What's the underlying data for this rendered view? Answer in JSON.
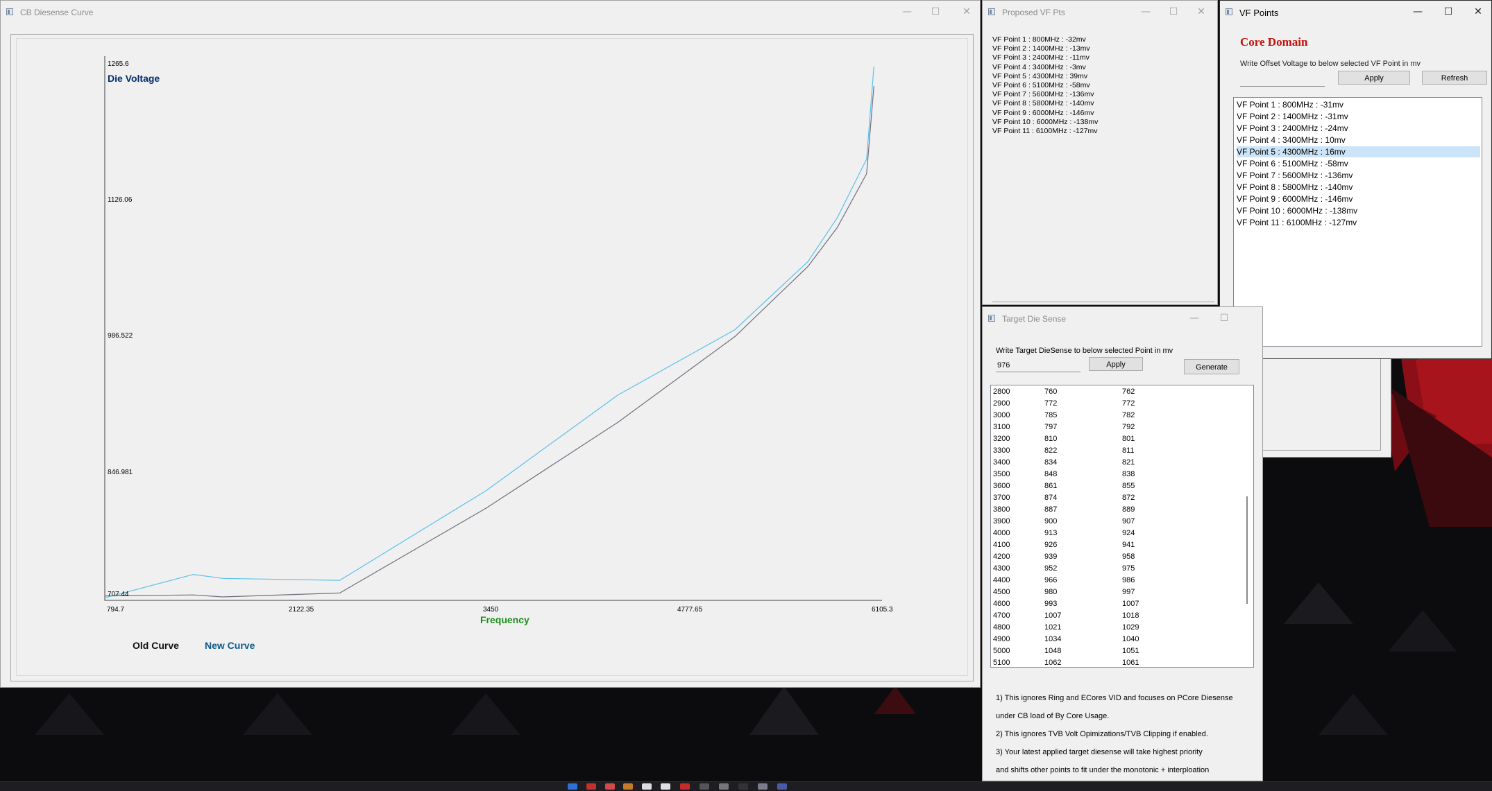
{
  "windows": {
    "curve": {
      "title": "CB Diesense Curve"
    },
    "proposed": {
      "title": "Proposed VF Pts",
      "items": [
        "VF Point 1 : 800MHz : -32mv",
        "VF Point 2 : 1400MHz : -13mv",
        "VF Point 3 : 2400MHz : -11mv",
        "VF Point 4 : 3400MHz : -3mv",
        "VF Point 5 : 4300MHz : 39mv",
        "VF Point 6 : 5100MHz : -58mv",
        "VF Point 7 : 5600MHz : -136mv",
        "VF Point 8 : 5800MHz : -140mv",
        "VF Point 9 : 6000MHz : -146mv",
        "VF Point 10 : 6000MHz : -138mv",
        "VF Point 11 : 6100MHz : -127mv"
      ]
    },
    "vfpoints": {
      "title": "VF Points",
      "heading": "Core Domain",
      "description": "Write Offset Voltage to below selected VF Point in mv",
      "offset_value": "",
      "apply_label": "Apply",
      "refresh_label": "Refresh",
      "selected_index": 4,
      "items": [
        "VF Point 1 : 800MHz : -31mv",
        "VF Point 2 : 1400MHz : -31mv",
        "VF Point 3 : 2400MHz : -24mv",
        "VF Point 4 : 3400MHz : 10mv",
        "VF Point 5 : 4300MHz : 16mv",
        "VF Point 6 : 5100MHz : -58mv",
        "VF Point 7 : 5600MHz : -136mv",
        "VF Point 8 : 5800MHz : -140mv",
        "VF Point 9 : 6000MHz : -146mv",
        "VF Point 10 : 6000MHz : -138mv",
        "VF Point 11 : 6100MHz : -127mv"
      ]
    },
    "target": {
      "title": "Target Die Sense",
      "description": "Write Target DieSense to below selected Point in mv",
      "input_value": "976",
      "apply_label": "Apply",
      "generate_label": "Generate",
      "rows": [
        [
          "2800",
          "760",
          "762"
        ],
        [
          "2900",
          "772",
          "772"
        ],
        [
          "3000",
          "785",
          "782"
        ],
        [
          "3100",
          "797",
          "792"
        ],
        [
          "3200",
          "810",
          "801"
        ],
        [
          "3300",
          "822",
          "811"
        ],
        [
          "3400",
          "834",
          "821"
        ],
        [
          "3500",
          "848",
          "838"
        ],
        [
          "3600",
          "861",
          "855"
        ],
        [
          "3700",
          "874",
          "872"
        ],
        [
          "3800",
          "887",
          "889"
        ],
        [
          "3900",
          "900",
          "907"
        ],
        [
          "4000",
          "913",
          "924"
        ],
        [
          "4100",
          "926",
          "941"
        ],
        [
          "4200",
          "939",
          "958"
        ],
        [
          "4300",
          "952",
          "975"
        ],
        [
          "4400",
          "966",
          "986"
        ],
        [
          "4500",
          "980",
          "997"
        ],
        [
          "4600",
          "993",
          "1007"
        ],
        [
          "4700",
          "1007",
          "1018"
        ],
        [
          "4800",
          "1021",
          "1029"
        ],
        [
          "4900",
          "1034",
          "1040"
        ],
        [
          "5000",
          "1048",
          "1051"
        ],
        [
          "5100",
          "1062",
          "1061"
        ]
      ],
      "notes": [
        "1) This ignores Ring and ECores VID and focuses on PCore Diesense",
        "under CB load of By Core Usage.",
        "2) This ignores TVB Volt Opimizations/TVB Clipping if enabled.",
        "3) Your latest applied target diesense will take highest priority",
        "and shifts other points to fit under the monotonic + interploation"
      ]
    }
  },
  "window_controls": {
    "minimize": "—",
    "maximize": "☐",
    "close": "✕"
  },
  "chart_data": {
    "type": "line",
    "xlabel": "Frequency",
    "ylabel": "Die Voltage",
    "x_ticks": [
      "794.7",
      "2122.35",
      "3450",
      "4777.65",
      "6105.3"
    ],
    "y_ticks": [
      "1265.6",
      "1126.06",
      "986.522",
      "846.981",
      "707.44"
    ],
    "xlim": [
      794.7,
      6105.3
    ],
    "ylim": [
      707.44,
      1265.6
    ],
    "legend": [
      "Old Curve",
      "New Curve"
    ],
    "colors": {
      "old": "#6f6f7e",
      "new": "#5bc0ea"
    },
    "series": [
      {
        "name": "Old Curve",
        "x": [
          794.7,
          1400,
          1600,
          2400,
          3400,
          4300,
          5100,
          5600,
          5800,
          6000,
          6050
        ],
        "y": [
          712,
          713,
          711,
          715,
          802,
          890,
          978,
          1050,
          1090,
          1145,
          1235
        ]
      },
      {
        "name": "New Curve",
        "x": [
          794.7,
          1400,
          1600,
          2400,
          3400,
          4300,
          5100,
          5600,
          5800,
          6000,
          6050
        ],
        "y": [
          710,
          734,
          730,
          728,
          820,
          918,
          985,
          1055,
          1100,
          1160,
          1255
        ]
      }
    ]
  }
}
